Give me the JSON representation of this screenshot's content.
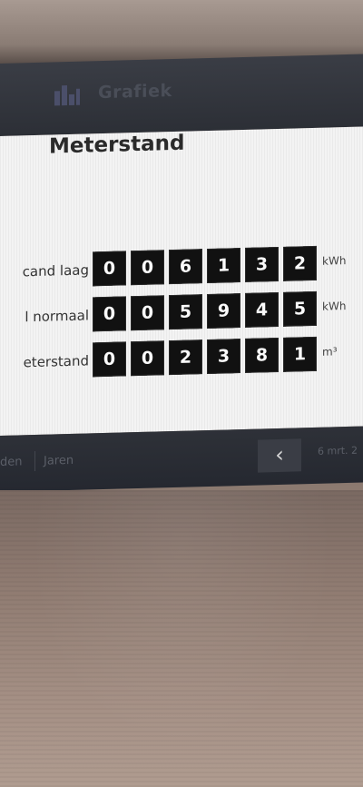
{
  "header": {
    "title": "Grafiek",
    "icon": "bar-chart-icon"
  },
  "panel": {
    "title": "Meterstand"
  },
  "meters": [
    {
      "label": "cand laag",
      "digits": [
        "0",
        "0",
        "6",
        "1",
        "3",
        "2"
      ],
      "unit": "kWh"
    },
    {
      "label": "l normaal",
      "digits": [
        "0",
        "0",
        "5",
        "9",
        "4",
        "5"
      ],
      "unit": "kWh"
    },
    {
      "label": "eterstand",
      "digits": [
        "0",
        "0",
        "2",
        "3",
        "8",
        "1"
      ],
      "unit": "m³"
    }
  ],
  "footer": {
    "tabs": [
      "den",
      "Jaren"
    ],
    "prev_label": "‹",
    "info": "6 mrt. 2"
  },
  "colors": {
    "header_bg": "#2c2f36",
    "panel_bg": "#f3f3f3",
    "digit_bg": "#111111",
    "digit_fg": "#fafafa"
  }
}
